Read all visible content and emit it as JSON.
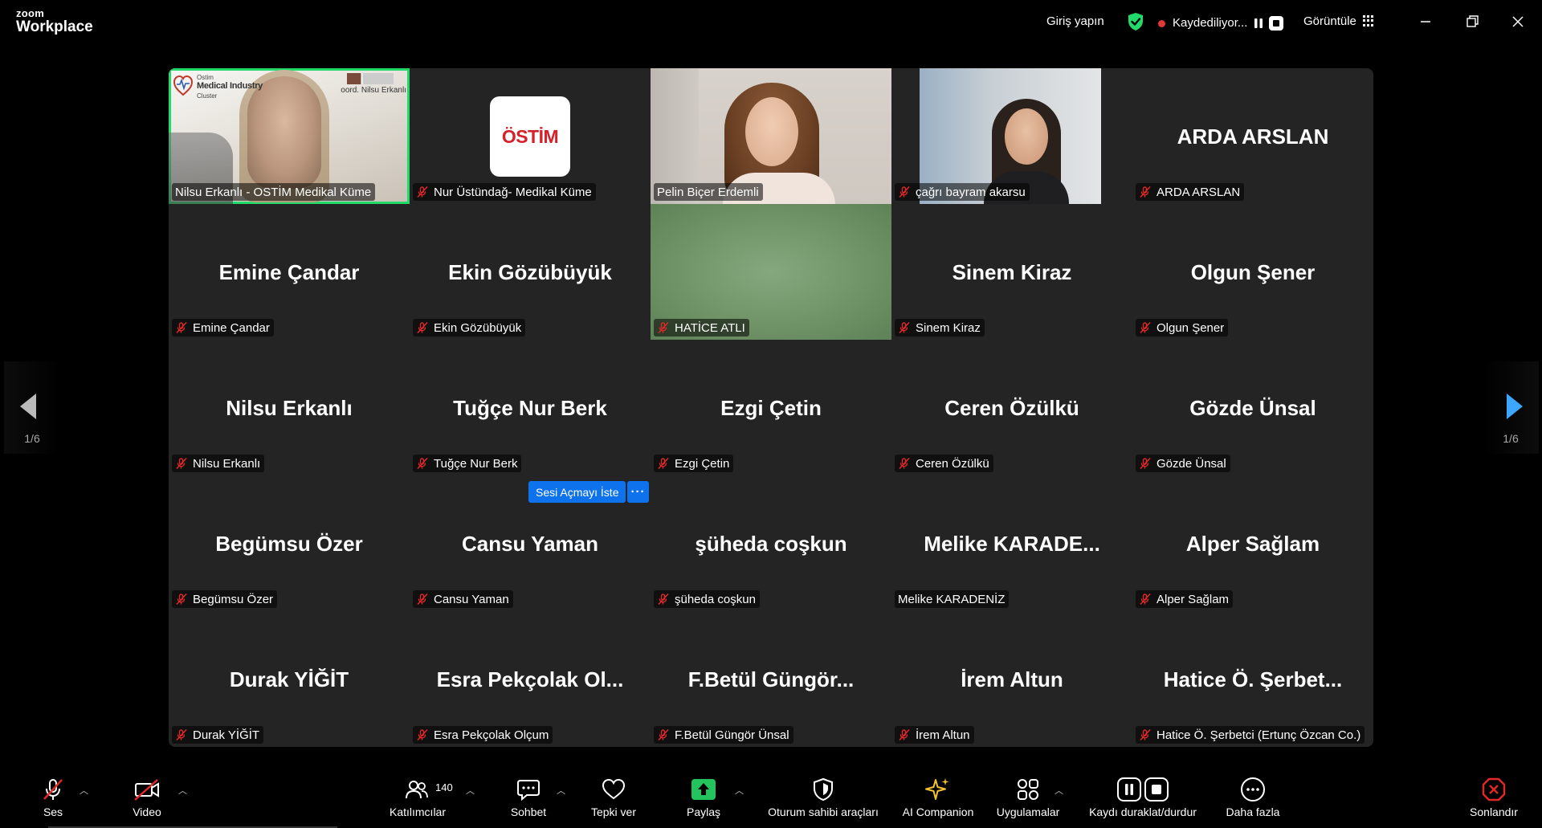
{
  "titlebar": {
    "brand_top": "zoom",
    "brand_bottom": "Workplace",
    "signin": "Giriş yapın",
    "recording": "Kaydediliyor...",
    "view": "Görüntüle"
  },
  "tiles": [
    {
      "label": "Nilsu Erkanlı - OSTİM Medikal Küme",
      "big": "",
      "kind": "video-nilsu",
      "muted": false
    },
    {
      "label": "Nur Üstündağ- Medikal Küme",
      "big": "",
      "kind": "ostim",
      "muted": true
    },
    {
      "label": "Pelin Biçer Erdemli",
      "big": "",
      "kind": "video-pelin",
      "muted": false
    },
    {
      "label": "çağrı bayram akarsu",
      "big": "",
      "kind": "video-cagri",
      "muted": true
    },
    {
      "label": "ARDA ARSLAN",
      "big": "ARDA ARSLAN",
      "kind": "name",
      "muted": true
    },
    {
      "label": "Emine Çandar",
      "big": "Emine Çandar",
      "kind": "name",
      "muted": true
    },
    {
      "label": "Ekin Gözübüyük",
      "big": "Ekin Gözübüyük",
      "kind": "name",
      "muted": true
    },
    {
      "label": "HATİCE ATLI",
      "big": "",
      "kind": "video-hatice",
      "muted": true
    },
    {
      "label": "Sinem Kiraz",
      "big": "Sinem Kiraz",
      "kind": "name",
      "muted": true
    },
    {
      "label": "Olgun Şener",
      "big": "Olgun Şener",
      "kind": "name",
      "muted": true
    },
    {
      "label": "Nilsu Erkanlı",
      "big": "Nilsu Erkanlı",
      "kind": "name",
      "muted": true
    },
    {
      "label": "Tuğçe Nur Berk",
      "big": "Tuğçe Nur Berk",
      "kind": "name",
      "muted": true
    },
    {
      "label": "Ezgi Çetin",
      "big": "Ezgi Çetin",
      "kind": "name",
      "muted": true
    },
    {
      "label": "Ceren Özülkü",
      "big": "Ceren Özülkü",
      "kind": "name",
      "muted": true
    },
    {
      "label": "Gözde Ünsal",
      "big": "Gözde Ünsal",
      "kind": "name",
      "muted": true
    },
    {
      "label": "Begümsu Özer",
      "big": "Begümsu Özer",
      "kind": "name",
      "muted": true
    },
    {
      "label": "Cansu Yaman",
      "big": "Cansu Yaman",
      "kind": "name",
      "muted": true
    },
    {
      "label": "şüheda coşkun",
      "big": "şüheda coşkun",
      "kind": "name",
      "muted": true
    },
    {
      "label": "Melike KARADENİZ",
      "big": "Melike  KARADE...",
      "kind": "name",
      "muted": false
    },
    {
      "label": "Alper Sağlam",
      "big": "Alper Sağlam",
      "kind": "name",
      "muted": true
    },
    {
      "label": "Durak YİĞİT",
      "big": "Durak YİĞİT",
      "kind": "name",
      "muted": true
    },
    {
      "label": "Esra Pekçolak Olçum",
      "big": "Esra  Pekçolak  Ol...",
      "kind": "name",
      "muted": true
    },
    {
      "label": "F.Betül Güngör Ünsal",
      "big": "F.Betül  Güngör...",
      "kind": "name",
      "muted": true
    },
    {
      "label": "İrem Altun",
      "big": "İrem Altun",
      "kind": "name",
      "muted": true
    },
    {
      "label": "Hatice Ö. Şerbetci (Ertunç Özcan Co.)",
      "big": "Hatice  Ö.  Şerbet...",
      "kind": "name",
      "muted": true
    }
  ],
  "nilsu_overlay": {
    "logo_line1": "Ostim",
    "logo_line2": "Medical Industry",
    "logo_line3": "Cluster",
    "coord": "oord. Nilsu Erkanlı"
  },
  "ostim_logo": "ÖSTİM",
  "popup": {
    "unmute": "Sesi Açmayı İste",
    "more": "···"
  },
  "pager": {
    "left": "1/6",
    "right": "1/6"
  },
  "toolbar": {
    "audio": "Ses",
    "video": "Video",
    "participants": "Katılımcılar",
    "participants_count": "140",
    "chat": "Sohbet",
    "react": "Tepki ver",
    "share": "Paylaş",
    "host_tools": "Oturum sahibi araçları",
    "ai": "AI Companion",
    "apps": "Uygulamalar",
    "record": "Kaydı duraklat/durdur",
    "more": "Daha fazla",
    "end": "Sonlandır"
  },
  "colors": {
    "accent_blue": "#0e72ed",
    "active_speaker": "#23d96a",
    "mute_red": "#e02828",
    "share_green": "#23c45e",
    "end_red": "#e02828",
    "tile_bg": "#242424"
  }
}
